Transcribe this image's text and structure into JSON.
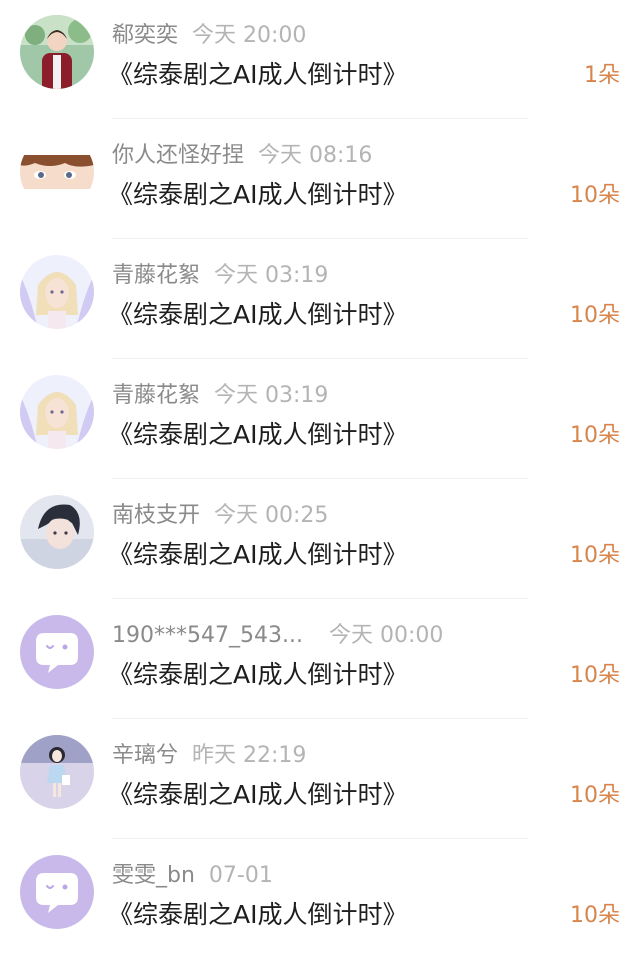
{
  "colors": {
    "name": "#8a8a8a",
    "time": "#b4b4b4",
    "title": "#1e1e1e",
    "gift_count": "#d8844a",
    "divider": "#efefef",
    "default_avatar_bg": "#c8b9ea"
  },
  "feed": {
    "items": [
      {
        "avatar": "user-photo-avatar",
        "name": "郗奕奕",
        "time": "今天 20:00",
        "title": "《综泰剧之AI成人倒计时》",
        "gift": "1朵"
      },
      {
        "avatar": "anime-boy-avatar",
        "name": "你人还怪好捏",
        "time": "今天 08:16",
        "title": "《综泰剧之AI成人倒计时》",
        "gift": "10朵"
      },
      {
        "avatar": "fairy-avatar",
        "name": "青藤花絮",
        "time": "今天 03:19",
        "title": "《综泰剧之AI成人倒计时》",
        "gift": "10朵"
      },
      {
        "avatar": "fairy-avatar",
        "name": "青藤花絮",
        "time": "今天 03:19",
        "title": "《综泰剧之AI成人倒计时》",
        "gift": "10朵"
      },
      {
        "avatar": "dark-hair-boy-avatar",
        "name": "南枝支开",
        "time": "今天 00:25",
        "title": "《综泰剧之AI成人倒计时》",
        "gift": "10朵"
      },
      {
        "avatar": "default-chat-bubble-avatar",
        "name": "190***547_543...",
        "time": "今天 00:00",
        "title": "《综泰剧之AI成人倒计时》",
        "gift": "10朵"
      },
      {
        "avatar": "girl-illustration-avatar",
        "name": "辛璃兮",
        "time": "昨天 22:19",
        "title": "《综泰剧之AI成人倒计时》",
        "gift": "10朵"
      },
      {
        "avatar": "default-chat-bubble-avatar",
        "name": "雯雯_bn",
        "time": "07-01",
        "title": "《综泰剧之AI成人倒计时》",
        "gift": "10朵"
      }
    ]
  }
}
